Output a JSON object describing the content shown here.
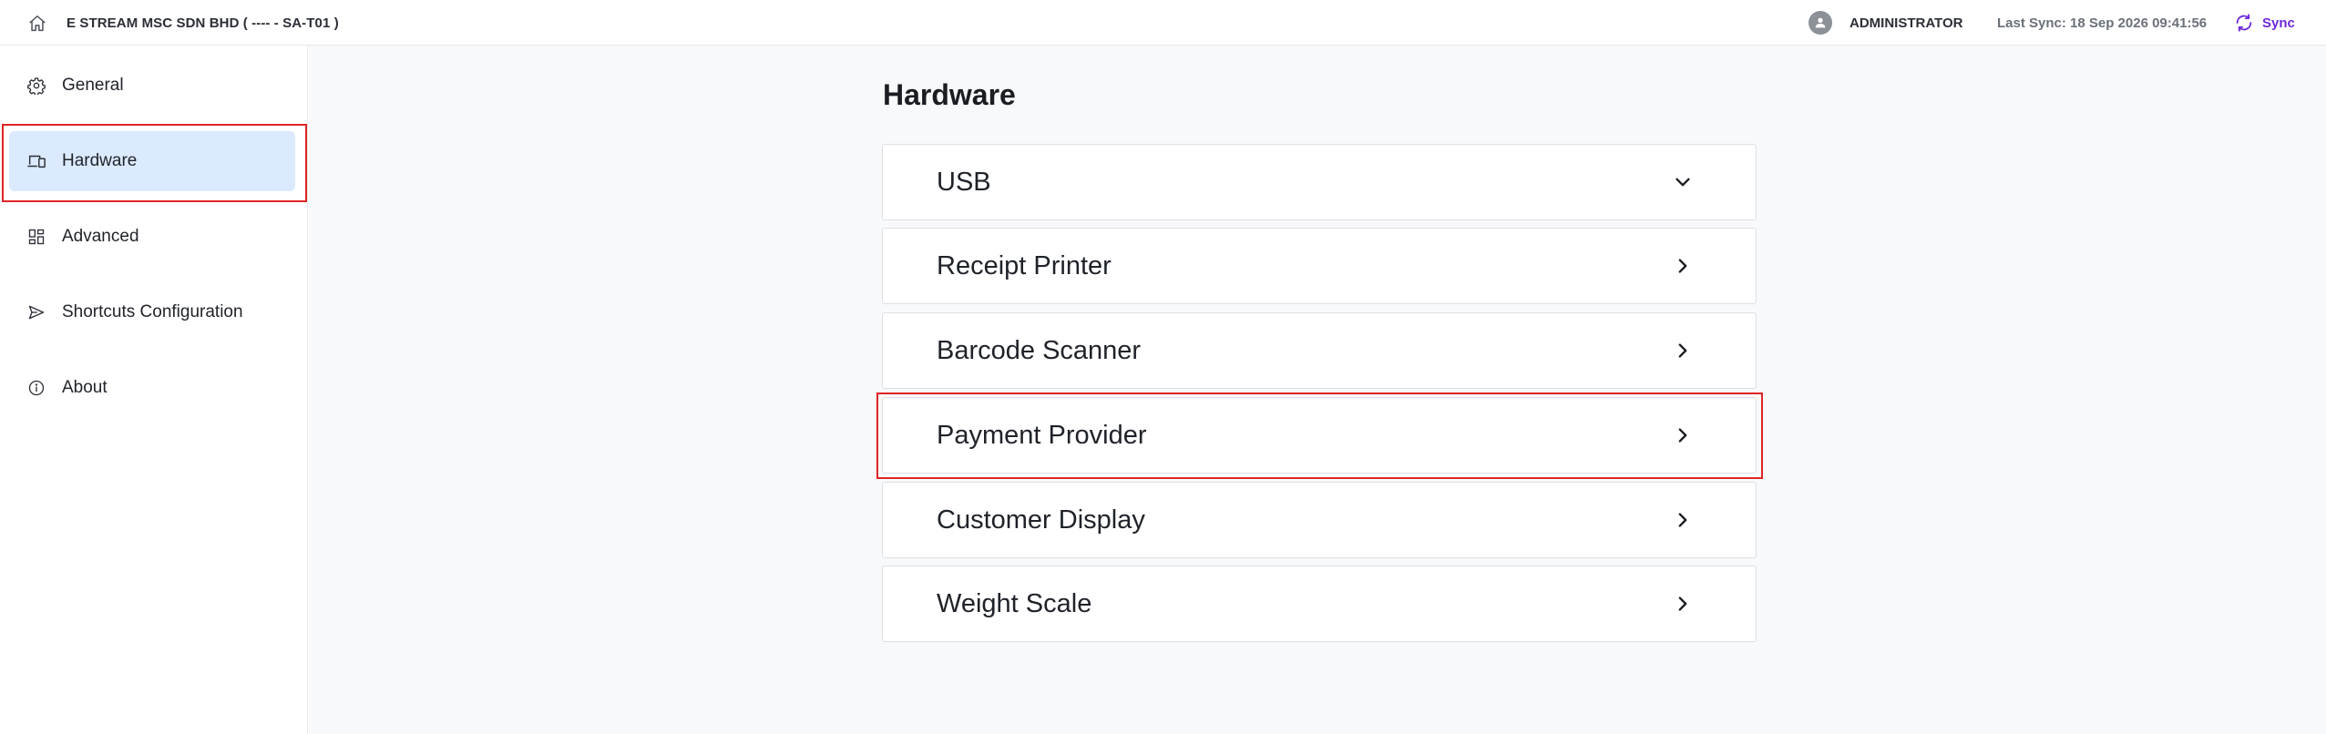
{
  "topbar": {
    "home_icon": "home-icon",
    "store_name": "E STREAM MSC SDN BHD ( ---- - SA-T01 )",
    "user_icon": "user-avatar-icon",
    "user_name": "ADMINISTRATOR",
    "last_sync": "Last Sync: 18 Sep 2026 09:41:56",
    "sync_icon": "sync-icon",
    "sync_label": "Sync",
    "accent_color": "#6d28d9"
  },
  "sidebar": {
    "active_item": "Hardware",
    "active_bg": "#dbeafe",
    "items": [
      {
        "label": "General",
        "icon": "gear-icon"
      },
      {
        "label": "Hardware",
        "icon": "devices-icon"
      },
      {
        "label": "Advanced",
        "icon": "dashboard-icon"
      },
      {
        "label": "Shortcuts Configuration",
        "icon": "send-icon"
      },
      {
        "label": "About",
        "icon": "info-icon"
      }
    ]
  },
  "main": {
    "title": "Hardware",
    "items": [
      {
        "label": "USB",
        "icon": "chevron-down-icon",
        "expanded": true
      },
      {
        "label": "Receipt Printer",
        "icon": "chevron-right-icon"
      },
      {
        "label": "Barcode Scanner",
        "icon": "chevron-right-icon"
      },
      {
        "label": "Payment Provider",
        "icon": "chevron-right-icon"
      },
      {
        "label": "Customer Display",
        "icon": "chevron-right-icon"
      },
      {
        "label": "Weight Scale",
        "icon": "chevron-right-icon"
      }
    ]
  },
  "highlights": {
    "color": "#e02424",
    "targets": [
      "Hardware",
      "Payment Provider"
    ]
  }
}
